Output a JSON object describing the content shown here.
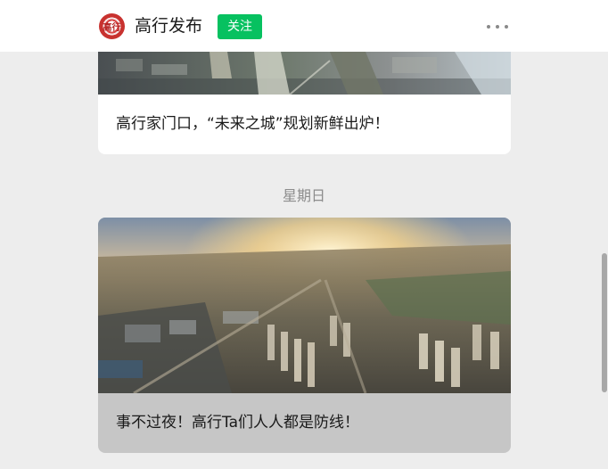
{
  "header": {
    "account_name": "高行发布",
    "logo_text": "高行",
    "follow_label": "关注",
    "more_icon": "more-horizontal-icon"
  },
  "articles": [
    {
      "title": "高行家门口，“未来之城”规划新鲜出炉！",
      "image": "city-aerial-photo"
    },
    {
      "title": "事不过夜！高行Ta们人人都是防线！",
      "image": "sunrise-city-aerial-photo"
    }
  ],
  "day_divider": "星期日",
  "colors": {
    "follow_button": "#07c160",
    "background": "#ededed",
    "card": "#ffffff",
    "pressed_card": "#c6c6c6"
  }
}
